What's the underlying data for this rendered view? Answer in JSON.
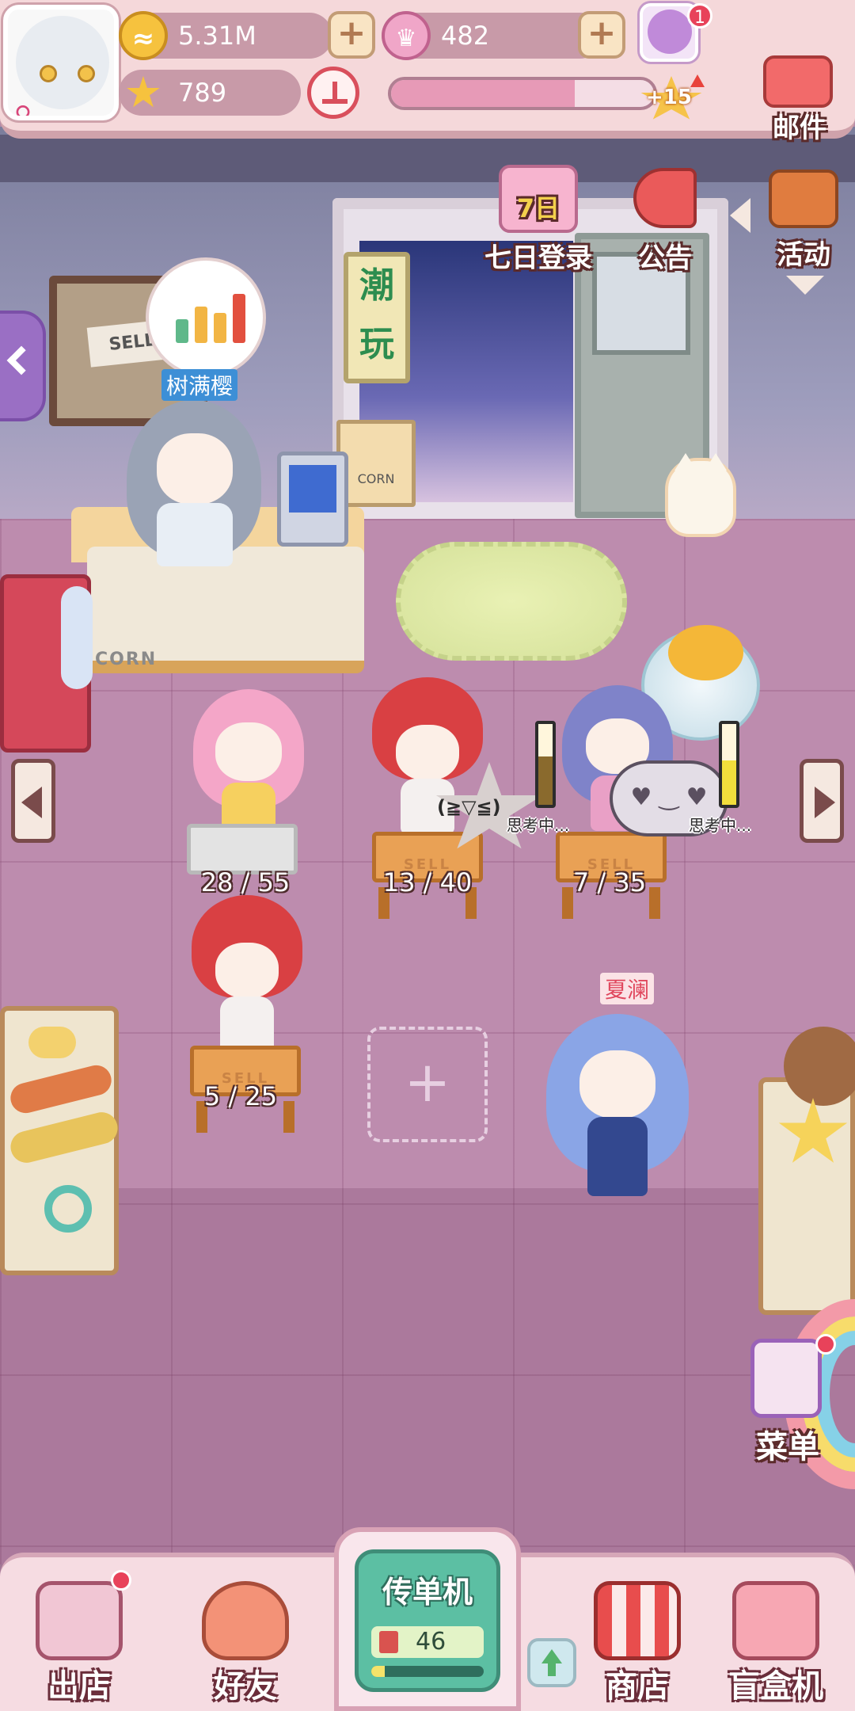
{
  "hud": {
    "coins": "5.31M",
    "crowns": "482",
    "stars": "789",
    "level_bonus": "+15",
    "friend_badge": "1",
    "xp_progress": 0.7
  },
  "features": {
    "mail": "邮件",
    "seven_day_login": "七日登录",
    "seven_day_badge": "7日",
    "notice": "公告",
    "events": "活动",
    "menu": "菜单"
  },
  "shop": {
    "door_sign": "潮玩",
    "board_sign": "SELL",
    "small_sign": "CORN",
    "counter_label": "CORN",
    "cashier_name": "树满樱",
    "customer_name": "夏澜"
  },
  "stands": [
    {
      "count": "28 / 55"
    },
    {
      "count": "13 / 40"
    },
    {
      "count": "7 / 35"
    },
    {
      "count": "5 / 25"
    }
  ],
  "stand_tag": "SELL",
  "thoughts": [
    {
      "label": "思考中..."
    },
    {
      "label": "思考中..."
    }
  ],
  "speech_star": "(≧▽≦)",
  "empty_slot": "+",
  "bottom": {
    "go_out": "出店",
    "friends": "好友",
    "flyer_title": "传单机",
    "flyer_count": "46",
    "flyer_progress": 0.12,
    "shop": "商店",
    "blind_box": "盲盒机"
  },
  "colors": {
    "hud_bg": "#f5d8da",
    "resource_bar": "#c89aa8",
    "floor": "#bd8cae",
    "flyer_green": "#5cbfa3",
    "alert_red": "#e8425a"
  }
}
